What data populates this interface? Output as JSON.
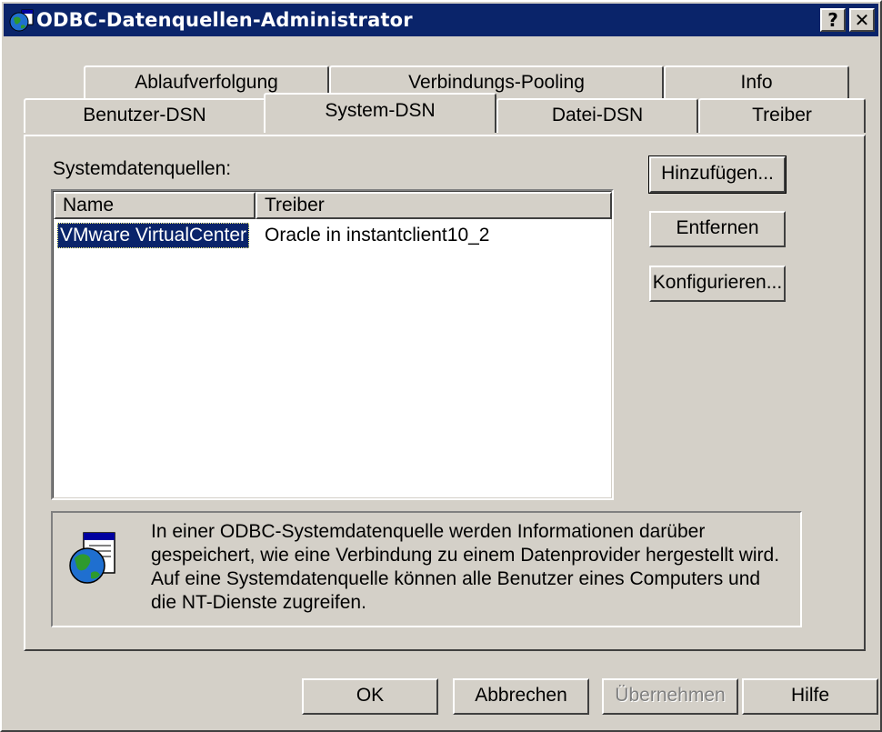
{
  "window": {
    "title": "ODBC-Datenquellen-Administrator",
    "help_button": "?",
    "close_button": "✕"
  },
  "tabs": {
    "row1": [
      "Ablaufverfolgung",
      "Verbindungs-Pooling",
      "Info"
    ],
    "row2": [
      "Benutzer-DSN",
      "System-DSN",
      "Datei-DSN",
      "Treiber"
    ],
    "active": "System-DSN"
  },
  "panel": {
    "list_label": "Systemdatenquellen:",
    "columns": [
      "Name",
      "Treiber"
    ],
    "rows": [
      {
        "name": "VMware VirtualCenter",
        "driver": "Oracle in instantclient10_2",
        "selected": true
      }
    ],
    "buttons": {
      "add": "Hinzufügen...",
      "remove": "Entfernen",
      "configure": "Konfigurieren..."
    },
    "info_text": "In einer ODBC-Systemdatenquelle werden Informationen darüber\ngespeichert, wie eine Verbindung zu einem Datenprovider hergestellt wird.\nAuf eine Systemdatenquelle können alle Benutzer eines Computers und\ndie NT-Dienste  zugreifen."
  },
  "footer": {
    "ok": "OK",
    "cancel": "Abbrechen",
    "apply": "Übernehmen",
    "help": "Hilfe"
  },
  "colors": {
    "titlebar": "#0a246a",
    "face": "#d4d0c8",
    "selection": "#0a246a"
  }
}
